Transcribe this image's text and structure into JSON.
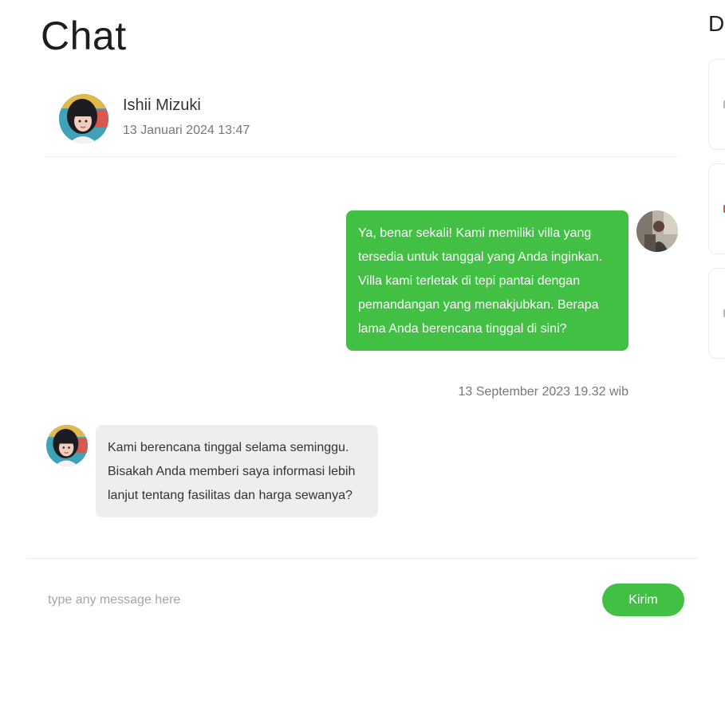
{
  "page": {
    "title": "Chat",
    "side_panel_title_fragment": "D"
  },
  "contact": {
    "name": "Ishii Mizuki",
    "last_seen": "13 Januari 2024 13:47"
  },
  "messages": [
    {
      "direction": "outgoing",
      "text": "Ya, benar sekali! Kami memiliki villa yang tersedia untuk tanggal yang Anda inginkan. Villa kami terletak di tepi pantai dengan pemandangan yang menakjubkan. Berapa lama Anda berencana tinggal di sini?",
      "time": "13 September 2023 19.32 wib"
    },
    {
      "direction": "incoming",
      "text": "Kami berencana tinggal selama seminggu. Bisakah Anda memberi saya informasi lebih lanjut tentang fasilitas dan harga sewanya?"
    }
  ],
  "composer": {
    "placeholder": "type any message here",
    "value": "",
    "send_label": "Kirim"
  },
  "colors": {
    "accent": "#41c044",
    "incoming_bubble": "#eeeeee",
    "background": "#ffffff"
  }
}
